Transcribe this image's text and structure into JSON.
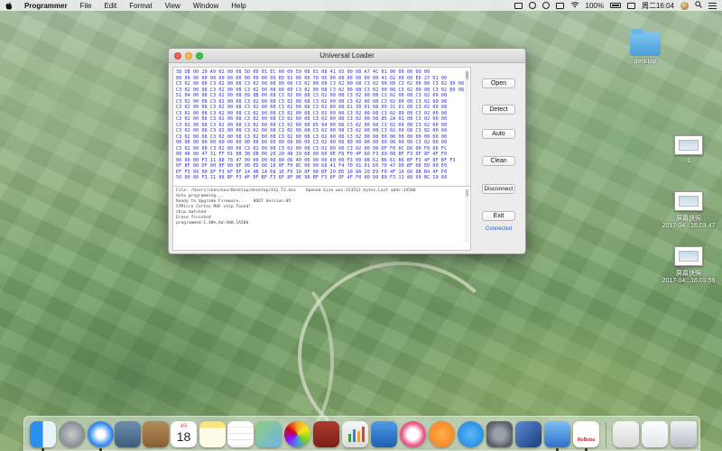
{
  "menubar": {
    "app_name": "Programmer",
    "items": [
      "File",
      "Edit",
      "Format",
      "View",
      "Window",
      "Help"
    ],
    "battery": "100%",
    "datetime": "周二16:04"
  },
  "desktop": {
    "icons": [
      {
        "label": "desktop",
        "type": "folder"
      },
      {
        "label": "1",
        "type": "screenshot"
      },
      {
        "label": "屏幕快照",
        "sublabel": "2017-04...16.03.47",
        "type": "screenshot"
      },
      {
        "label": "屏幕快照",
        "sublabel": "2017-04...16.03.59",
        "type": "screenshot"
      }
    ]
  },
  "window": {
    "title": "Universal Loader",
    "hex_lines": [
      "38 DB 00 20 A9 02 00 08 5D 00 01 EC 00 09 59 08 01 08 41 93 00 08 A7 4C 01 00 00 00 00 00",
      "00 00 00 00 00 00 00 00 00 00 00 00 ED 01 00 00 70 95 00 08 00 00 00 00 41 02 00 08 ED 27 01 00",
      "C3 02 00 08 C3 02 00 08 C3 02 00 08 00 00 C3 02 00 08 C3 02 00 08 C3 02 00 08 C3 02 00 08 C3 02 00 08",
      "C3 02 00 08 C3 02 00 08 C3 02 00 08 00 00 C3 02 00 08 C3 02 00 08 C3 02 00 08 C3 02 00 08 C3 02 00 08",
      "51 04 00 08 C3 02 00 08 09 8B 00 08 C3 02 00 08 C3 02 00 08 C3 02 00 08 C3 02 00 08 C3 02 00 08",
      "C3 02 00 08 C3 02 00 08 C3 02 00 08 C3 02 00 08 C3 02 00 08 C3 02 00 08 C3 02 00 08 C3 02 00 08",
      "C3 02 00 08 C3 02 00 08 C3 02 00 08 C3 02 00 08 C3 02 00 08 D1 30 01 08 09 31 01 08 C3 02 00 08",
      "C3 02 00 08 C3 02 00 08 C3 02 00 08 C3 02 00 08 C3 02 00 08 C3 02 00 08 C3 02 00 08 C3 02 00 08",
      "C3 02 00 08 C3 02 00 08 C3 02 00 08 C3 02 00 08 C3 02 00 08 C3 02 00 08 85 2A 01 08 C3 02 00 08",
      "C3 02 00 08 C3 02 00 08 C3 02 00 08 C3 02 00 08 D5 94 00 08 C3 02 00 08 C3 02 00 08 C3 02 00 08",
      "C3 02 00 08 C3 02 00 08 C3 02 00 08 C3 02 00 08 C3 02 00 08 C3 02 00 08 C3 02 00 08 C3 02 00 08",
      "C3 02 00 08 C3 02 00 08 C3 02 00 08 C3 02 00 08 C3 02 00 08 C3 02 00 08 00 00 00 00 00 00 00 00",
      "00 00 00 00 00 00 00 00 00 00 00 00 00 00 00 00 C3 02 00 08 00 00 00 00 00 00 00 00 C3 02 00 08",
      "C3 02 00 08 C3 02 00 08 C3 02 00 08 C3 02 00 08 C3 02 00 08 C3 02 00 08 DF F8 0C D0 00 F0 06 FC",
      "00 48 00 47 31 FF 01 08 38 DB 00 20 20 48 19 68 00 60 0E F8 F0 4F 60 F3 09 08 BF F3 6F 8F 4F F0",
      "00 00 00 F3 11 88 70 47 00 00 00 00 00 06 40 00 00 00 60 00 F3 00 08 62 B6 61 B6 BF F3 4F 8F BF F3",
      "6F 8F 00 DF 00 8F 00 8F 00 ED 00 10 0F F0 8C 00 00 68 41 F4 70 01 01 60 70 47 00 BF 08 ED 00 E0",
      "EF F3 09 00 8F F3 6F 8F 14 4B 1A 68 1E F0 10 0F 08 BF 20 ED 10 8A 20 E9 F0 4F 10 60 0B B4 4F F0",
      "50 00 80 F3 11 88 BF F3 4F 8F BF F3 6F 8F 0E 98 BF F3 6F 8F 4F F0 00 00 80 F3 11 88 09 BC 19 68"
    ],
    "log_lines": [
      "File: /Users/chenchao/Desktop/desktop/412_T3.hex    Opened Size was:153512 bytes,Last addr:1A580",
      "Auto programming...",
      "Ready to Upgrade Firmware...   BOOT Version:05",
      "STMicro Cortex M4F chip found!",
      "chip matched",
      "Erase finished",
      "programmed:1.40%,Ad:A00,1A580"
    ],
    "buttons": {
      "open": "Open",
      "detect": "Detect",
      "auto": "Auto",
      "clean": "Clean",
      "disconnect": "Disconnect",
      "exit": "Exit"
    },
    "status": "Connected"
  },
  "colors": {
    "hex_text": "#2a2ad8",
    "status_link": "#2060d0",
    "close": "#fc605c",
    "minimize": "#fdbc40",
    "maximize": "#34c84a"
  },
  "dock": {
    "icons": [
      "finder-icon",
      "launchpad-icon",
      "safari-icon",
      "preview-icon",
      "contacts-icon",
      "calendar-icon",
      "notes-icon",
      "reminders-icon",
      "maps-icon",
      "photos-icon",
      "dictionary-icon",
      "numbers-icon",
      "keynote-icon",
      "music-icon",
      "books-icon",
      "app-store-icon",
      "system-preferences-icon",
      "virtualbox-icon",
      "xcode-icon",
      "robotics-app-icon",
      "downloads-stack-icon",
      "documents-stack-icon",
      "trash-icon"
    ],
    "calendar_day": "18",
    "calendar_month": "4月",
    "robotics_label": "RoBoba"
  }
}
